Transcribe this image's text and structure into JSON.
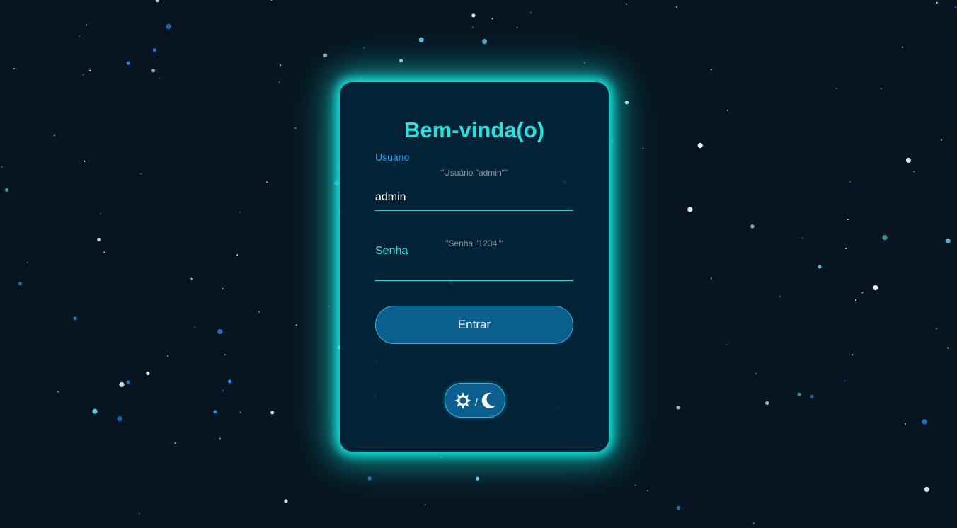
{
  "login": {
    "title": "Bem-vinda(o)",
    "user_label": "Usuário",
    "user_hint": "\"Usuário \"admin\"\"",
    "user_value": "admin",
    "password_label": "Senha",
    "password_hint": "\"Senha \"1234\"\"",
    "password_value": "",
    "submit_label": "Entrar",
    "theme_toggle": {
      "light_icon": "sun-icon",
      "separator": "/",
      "dark_icon": "moon-icon"
    }
  },
  "colors": {
    "background": "#071520",
    "card_background": "#022438",
    "glow": "#14ebe1",
    "accent_cyan": "#22e4e0",
    "accent_blue": "#1aa6ff",
    "button": "#0a5f8e"
  }
}
